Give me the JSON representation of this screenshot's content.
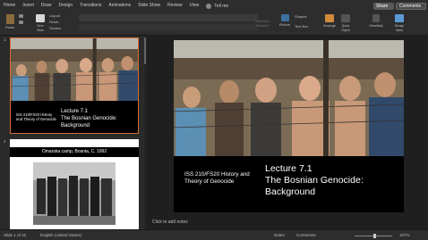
{
  "ribbon_tabs": [
    "Home",
    "Insert",
    "Draw",
    "Design",
    "Transitions",
    "Animations",
    "Slide Show",
    "Review",
    "View"
  ],
  "active_tab": "Home",
  "tell_me": "Tell me",
  "share_label": "Share",
  "comments_label": "Comments",
  "ribbon": {
    "paste": "Paste",
    "new_slide": "New Slide",
    "layout": "Layout",
    "reset": "Reset",
    "section": "Section",
    "convert": "Convert to SmartArt",
    "picture": "Picture",
    "shapes": "Shapes",
    "text_box": "Text Box",
    "arrange": "Arrange",
    "quick_styles": "Quick Styles",
    "sensitivity": "Sensitivity",
    "design_ideas": "Design Ideas"
  },
  "slides": [
    {
      "number": "1",
      "course": "ISS 210/FS20 History and Theory of Genocide",
      "lecture": "Lecture 7.1",
      "title": "The Bosnian Genocide: Background"
    },
    {
      "number": "2",
      "caption": "Omarska camp, Bosnia, C. 1992"
    }
  ],
  "main": {
    "course": "ISS 210/FS20 History and Theory of Genocide",
    "lecture": "Lecture 7.1",
    "title": "The Bosnian Genocide: Background"
  },
  "notes_placeholder": "Click to add notes",
  "status": {
    "slide_counter": "Slide 1 of 16",
    "language": "English (United States)",
    "notes": "Notes",
    "comments": "Comments",
    "zoom": "107%"
  },
  "colors": {
    "accent": "#e07a3a",
    "ribbon_bg": "#2d2d2d",
    "editor_bg": "#1f1f1f"
  }
}
